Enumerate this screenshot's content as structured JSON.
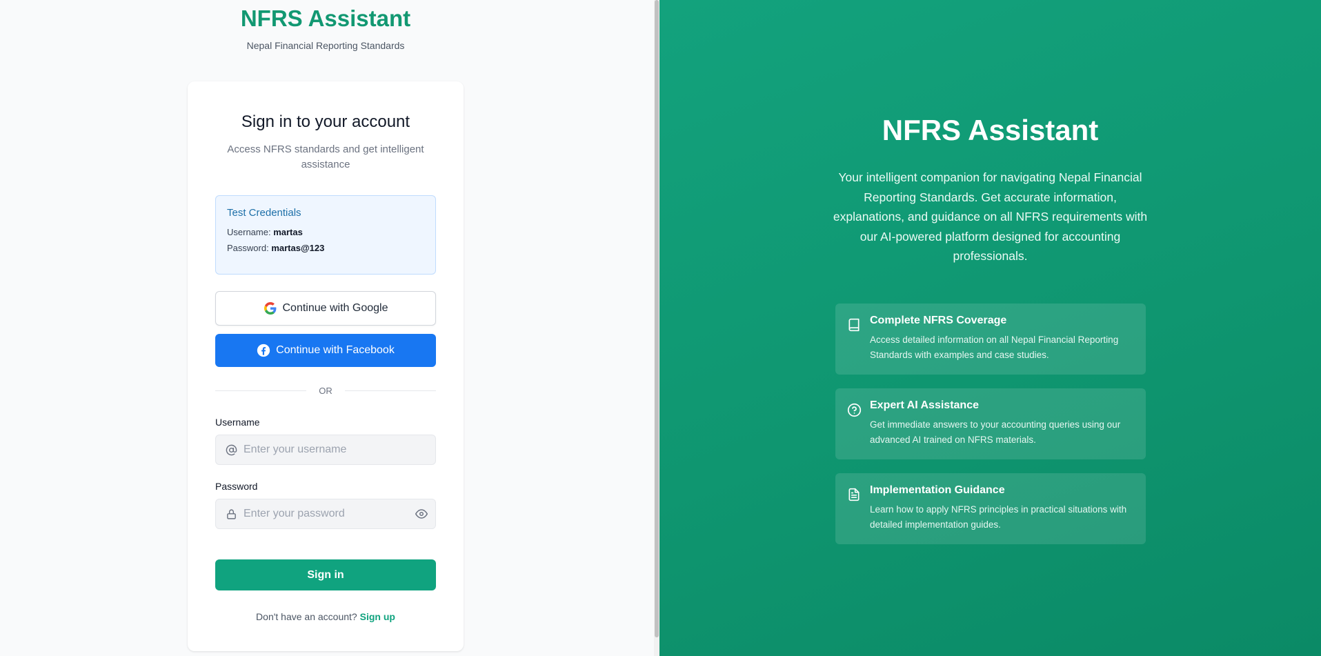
{
  "brand": {
    "title": "NFRS Assistant",
    "subtitle": "Nepal Financial Reporting Standards"
  },
  "card": {
    "title": "Sign in to your account",
    "subtitle": "Access NFRS standards and get intelligent assistance",
    "test_credentials": {
      "title": "Test Credentials",
      "username_label": "Username:",
      "username_value": "martas",
      "password_label": "Password:",
      "password_value": "martas@123"
    },
    "google_button": "Continue with Google",
    "facebook_button": "Continue with Facebook",
    "divider": "OR",
    "username": {
      "label": "Username",
      "placeholder": "Enter your username"
    },
    "password": {
      "label": "Password",
      "placeholder": "Enter your password"
    },
    "signin_button": "Sign in",
    "signup_prompt": "Don't have an account?",
    "signup_link": "Sign up"
  },
  "hero": {
    "title": "NFRS Assistant",
    "description": "Your intelligent companion for navigating Nepal Financial Reporting Standards. Get accurate information, explanations, and guidance on all NFRS requirements with our AI-powered platform designed for accounting professionals.",
    "features": [
      {
        "icon": "book-icon",
        "title": "Complete NFRS Coverage",
        "description": "Access detailed information on all Nepal Financial Reporting Standards with examples and case studies."
      },
      {
        "icon": "question-circle-icon",
        "title": "Expert AI Assistance",
        "description": "Get immediate answers to your accounting queries using our advanced AI trained on NFRS materials."
      },
      {
        "icon": "document-icon",
        "title": "Implementation Guidance",
        "description": "Learn how to apply NFRS principles in practical situations with detailed implementation guides."
      }
    ]
  },
  "colors": {
    "brand_green": "#10a37f",
    "facebook_blue": "#1877f2",
    "hero_bg": "#0f9670"
  }
}
